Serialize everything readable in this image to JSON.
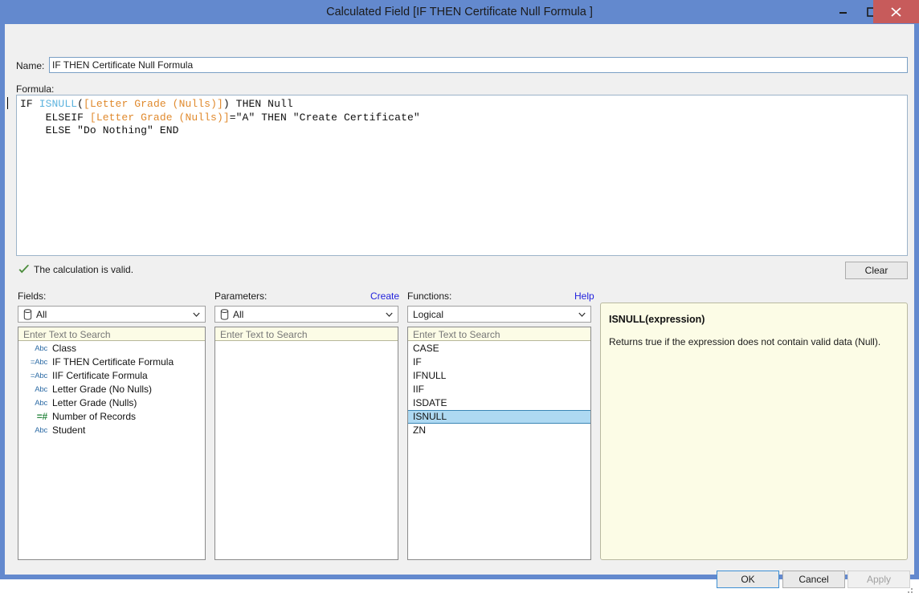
{
  "window": {
    "title": "Calculated Field [IF THEN Certificate Null Formula ]",
    "minimize_label": "Minimize",
    "maximize_label": "Maximize",
    "close_label": "Close",
    "frame_color": "#6389ce",
    "close_color": "#c75b5b"
  },
  "name_field": {
    "label": "Name:",
    "value": "IF THEN Certificate Null Formula",
    "placeholder": ""
  },
  "formula": {
    "label": "Formula:",
    "lines": [
      [
        {
          "text": "IF ",
          "kind": "plain"
        },
        {
          "text": "ISNULL",
          "kind": "function"
        },
        {
          "text": "(",
          "kind": "plain"
        },
        {
          "text": "[Letter Grade (Nulls)]",
          "kind": "field"
        },
        {
          "text": ") THEN Null",
          "kind": "plain"
        }
      ],
      [
        {
          "text": "    ELSEIF ",
          "kind": "plain"
        },
        {
          "text": "[Letter Grade (Nulls)]",
          "kind": "field"
        },
        {
          "text": "=\"A\" THEN \"Create Certificate\"",
          "kind": "plain"
        }
      ],
      [
        {
          "text": "    ELSE \"Do Nothing\" END",
          "kind": "plain"
        }
      ]
    ],
    "plain_text": "IF ISNULL([Letter Grade (Nulls)]) THEN Null\n    ELSEIF [Letter Grade (Nulls)]=\"A\" THEN \"Create Certificate\"\n    ELSE \"Do Nothing\" END",
    "colors": {
      "function": "#5cb3de",
      "field": "#e08a2e",
      "plain": "#101010"
    }
  },
  "validity": {
    "icon": "check-icon",
    "text": "The calculation is valid.",
    "color": "#4b8c3b"
  },
  "clear_button": {
    "label": "Clear"
  },
  "fields_column": {
    "label": "Fields:",
    "filter": {
      "value": "All",
      "icon": "database-icon"
    },
    "search_placeholder": "Enter Text to Search",
    "search_value": "",
    "items": [
      {
        "icon": "Abc",
        "icon_type": "string",
        "label": "Class"
      },
      {
        "icon": "=Abc",
        "icon_type": "calc-string",
        "label": "IF THEN Certificate Formula"
      },
      {
        "icon": "=Abc",
        "icon_type": "calc-string",
        "label": "IIF Certificate Formula"
      },
      {
        "icon": "Abc",
        "icon_type": "string",
        "label": "Letter Grade (No Nulls)"
      },
      {
        "icon": "Abc",
        "icon_type": "string",
        "label": "Letter Grade (Nulls)"
      },
      {
        "icon": "=#",
        "icon_type": "calc-numeric",
        "label": "Number of Records"
      },
      {
        "icon": "Abc",
        "icon_type": "string",
        "label": "Student"
      }
    ]
  },
  "parameters_column": {
    "label": "Parameters:",
    "create_link": "Create",
    "filter": {
      "value": "All",
      "icon": "database-icon"
    },
    "search_placeholder": "Enter Text to Search",
    "search_value": "",
    "items": []
  },
  "functions_column": {
    "label": "Functions:",
    "help_link": "Help",
    "filter": {
      "value": "Logical",
      "icon": "none"
    },
    "search_placeholder": "Enter Text to Search",
    "search_value": "",
    "items": [
      {
        "label": "CASE",
        "selected": false
      },
      {
        "label": "IF",
        "selected": false
      },
      {
        "label": "IFNULL",
        "selected": false
      },
      {
        "label": "IIF",
        "selected": false
      },
      {
        "label": "ISDATE",
        "selected": false
      },
      {
        "label": "ISNULL",
        "selected": true
      },
      {
        "label": "ZN",
        "selected": false
      }
    ],
    "selection_color": "#aed9f2"
  },
  "help_panel": {
    "title": "ISNULL(expression)",
    "description": "Returns true if the expression does not contain valid data (Null)."
  },
  "buttons": {
    "ok": "OK",
    "cancel": "Cancel",
    "apply": "Apply",
    "apply_disabled": true
  }
}
